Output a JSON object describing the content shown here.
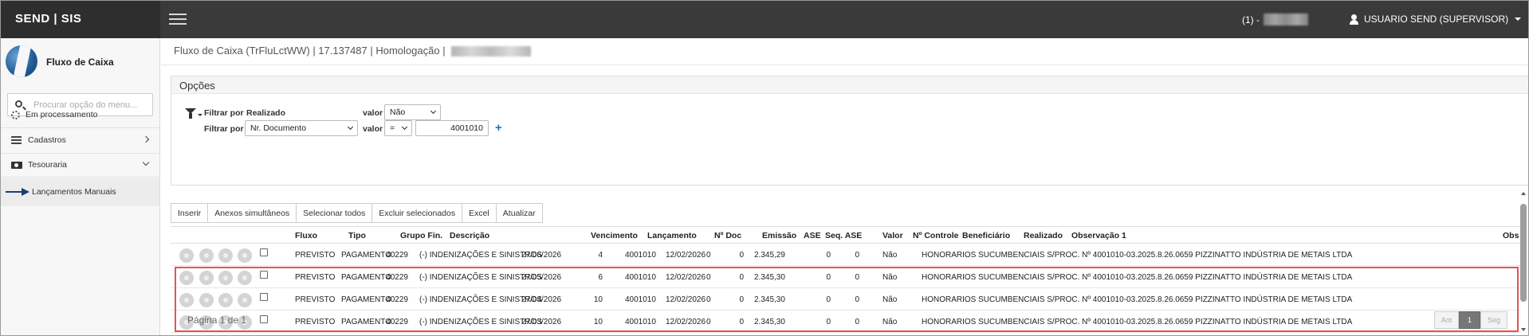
{
  "app": {
    "brand": "SEND | SIS",
    "env_prefix": "(1) -",
    "user": "USUARIO SEND (SUPERVISOR)"
  },
  "sidebar": {
    "title": "Fluxo de Caixa",
    "search_placeholder": "Procurar opção do menu...",
    "items": [
      {
        "label": "Em processamento",
        "icon": "spinner-icon"
      },
      {
        "label": "Cadastros",
        "icon": "list-icon"
      },
      {
        "label": "Tesouraria",
        "icon": "money-icon"
      }
    ],
    "subitem": "Lançamentos Manuais"
  },
  "page": {
    "breadcrumb": "Fluxo de Caixa (TrFluLctWW) | 17.137487 | Homologação |"
  },
  "options": {
    "title": "Opções",
    "filter_label": "Filtrar por",
    "value_label": "valor",
    "filter1_field": "Realizado",
    "filter1_value": "Não",
    "filter2_field": "Nr. Documento",
    "filter2_operator": "=",
    "filter2_value": "4001010",
    "add_symbol": "+"
  },
  "toolbar": {
    "insert": "Inserir",
    "concurrent": "Anexos simultâneos",
    "select_all": "Selecionar todos",
    "delete_selected": "Excluir selecionados",
    "excel": "Excel",
    "refresh": "Atualizar"
  },
  "table": {
    "columns": {
      "fluxo": "Fluxo",
      "tipo": "Tipo",
      "grupo": "Grupo Fin.",
      "descricao": "Descrição",
      "vencimento": "Vencimento",
      "lancamento": "Lançamento",
      "ndoc": "Nº Doc",
      "emissao": "Emissão",
      "ase": "ASE",
      "seqase": "Seq. ASE",
      "valor": "Valor",
      "ncontrole": "Nº Controle",
      "beneficiario": "Beneficiário",
      "realizado": "Realizado",
      "obs1": "Observação 1",
      "obs": "Obs"
    },
    "rows": [
      {
        "fluxo": "PREVISTO",
        "tipo": "PAGAMENTO",
        "grupo": "40229",
        "descricao": "(-) INDENIZAÇÕES E SINISTROS",
        "vencimento": "27/06/2026",
        "lancamento": "4",
        "ndoc": "4001010",
        "emissao": "12/02/2026",
        "ase": "0",
        "seqase": "0",
        "valor": "2.345,29",
        "ncontrole": "0",
        "beneficiario": "0",
        "realizado": "Não",
        "obs1": "HONORARIOS SUCUMBENCIAIS S/PROC. Nº 4001010-03.2025.8.26.0659 PIZZINATTO INDÚSTRIA DE METAIS LTDA"
      },
      {
        "fluxo": "PREVISTO",
        "tipo": "PAGAMENTO",
        "grupo": "40229",
        "descricao": "(-) INDENIZAÇÕES E SINISTROS",
        "vencimento": "27/05/2026",
        "lancamento": "6",
        "ndoc": "4001010",
        "emissao": "12/02/2026",
        "ase": "0",
        "seqase": "0",
        "valor": "2.345,30",
        "ncontrole": "0",
        "beneficiario": "0",
        "realizado": "Não",
        "obs1": "HONORARIOS SUCUMBENCIAIS S/PROC. Nº 4001010-03.2025.8.26.0659 PIZZINATTO INDÚSTRIA DE METAIS LTDA"
      },
      {
        "fluxo": "PREVISTO",
        "tipo": "PAGAMENTO",
        "grupo": "40229",
        "descricao": "(-) INDENIZAÇÕES E SINISTROS",
        "vencimento": "27/04/2026",
        "lancamento": "10",
        "ndoc": "4001010",
        "emissao": "12/02/2026",
        "ase": "0",
        "seqase": "0",
        "valor": "2.345,30",
        "ncontrole": "0",
        "beneficiario": "0",
        "realizado": "Não",
        "obs1": "HONORARIOS SUCUMBENCIAIS S/PROC. Nº 4001010-03.2025.8.26.0659 PIZZINATTO INDÚSTRIA DE METAIS LTDA"
      },
      {
        "fluxo": "PREVISTO",
        "tipo": "PAGAMENTO",
        "grupo": "40229",
        "descricao": "(-) INDENIZAÇÕES E SINISTROS",
        "vencimento": "27/03/2026",
        "lancamento": "10",
        "ndoc": "4001010",
        "emissao": "12/02/2026",
        "ase": "0",
        "seqase": "0",
        "valor": "2.345,30",
        "ncontrole": "0",
        "beneficiario": "0",
        "realizado": "Não",
        "obs1": "HONORARIOS SUCUMBENCIAIS S/PROC. Nº 4001010-03.2025.8.26.0659 PIZZINATTO INDÚSTRIA DE METAIS LTDA"
      }
    ]
  },
  "pager": {
    "text": "Página 1 de 1",
    "prev": "Ant",
    "current": "1",
    "next": "Seg"
  },
  "colors": {
    "topbar": "#3a3a3a",
    "highlight": "#e05555",
    "accent": "#2a6ebb"
  }
}
